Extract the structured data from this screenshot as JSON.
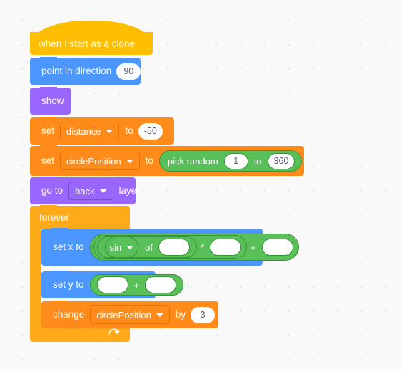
{
  "workspace": {
    "background_color": "#F9F9F9",
    "dot_color": "#E0E0E0"
  },
  "palette_colors": {
    "events": "#FFBF00",
    "motion": "#4C97FF",
    "looks": "#9966FF",
    "variables": "#FF8C1A",
    "control": "#FFAB19",
    "operators": "#59C059",
    "input_text": "#575E75"
  },
  "script": {
    "hat": {
      "label": "when I start as a clone"
    },
    "point_in_direction": {
      "label": "point in direction",
      "value": "90"
    },
    "show": {
      "label": "show"
    },
    "set_distance": {
      "set_label": "set",
      "variable": "distance",
      "to_label": "to",
      "value": "-50"
    },
    "set_circle_position": {
      "set_label": "set",
      "variable": "circlePosition",
      "to_label": "to",
      "pick_random": {
        "label": "pick random",
        "from": "1",
        "to_label": "to",
        "to": "360"
      }
    },
    "go_to_layer": {
      "go_to_label": "go to",
      "layer_option": "back",
      "layer_label": "layer"
    },
    "forever": {
      "label": "forever",
      "loop_arrow_icon": "loop-arrow-icon",
      "body": {
        "set_x_to": {
          "label": "set x to",
          "operator_add": {
            "symbol": "+",
            "right_operand": ""
          },
          "operator_multiply": {
            "symbol": "*",
            "right_operand": ""
          },
          "math_function": {
            "function": "sin",
            "of_label": "of",
            "operand": ""
          }
        },
        "set_y_to": {
          "label": "set y to",
          "operator_add": {
            "symbol": "+",
            "left_operand": "",
            "right_operand": ""
          }
        },
        "change_circle_position": {
          "change_label": "change",
          "variable": "circlePosition",
          "by_label": "by",
          "value": "3"
        }
      }
    }
  }
}
